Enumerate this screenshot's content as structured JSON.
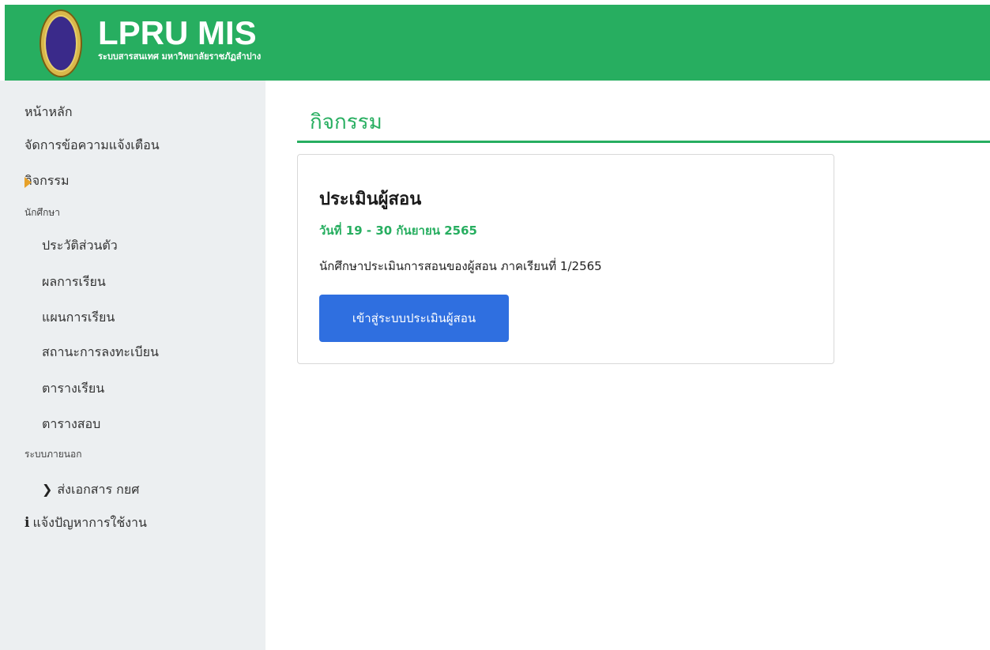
{
  "header": {
    "title": "LPRU MIS",
    "subtitle": "ระบบสารสนเทศ มหาวิทยาลัยราชภัฏลำปาง",
    "logo_icon": "university-seal-icon",
    "background_color": "#27ae60"
  },
  "sidebar": {
    "items": [
      {
        "label": "หน้าหลัก"
      },
      {
        "label": "จัดการข้อความแจ้งเตือน"
      },
      {
        "label": "กิจกรรม",
        "active": true
      },
      {
        "section": "นักศึกษา"
      },
      {
        "label": "ประวัติส่วนตัว"
      },
      {
        "label": "ผลการเรียน"
      },
      {
        "label": "แผนการเรียน"
      },
      {
        "label": "สถานะการลงทะเบียน"
      },
      {
        "label": "ตารางเรียน"
      },
      {
        "label": "ตารางสอบ"
      },
      {
        "section": "ระบบภายนอก"
      },
      {
        "label": "ส่งเอกสาร กยศ",
        "icon": "chevron-right-icon"
      },
      {
        "label": "แจ้งปัญหาการใช้งาน",
        "icon": "info-icon"
      }
    ],
    "active_marker_color": "#e6a12a"
  },
  "main": {
    "title": "กิจกรรม",
    "card": {
      "title": "ประเมินผู้สอน",
      "date": "วันที่ 19 - 30 กันยายน 2565",
      "description": "นักศึกษาประเมินการสอนของผู้สอน ภาคเรียนที่ 1/2565",
      "button_label": "เข้าสู่ระบบประเมินผู้สอน",
      "button_color": "#2f6fe0"
    }
  }
}
